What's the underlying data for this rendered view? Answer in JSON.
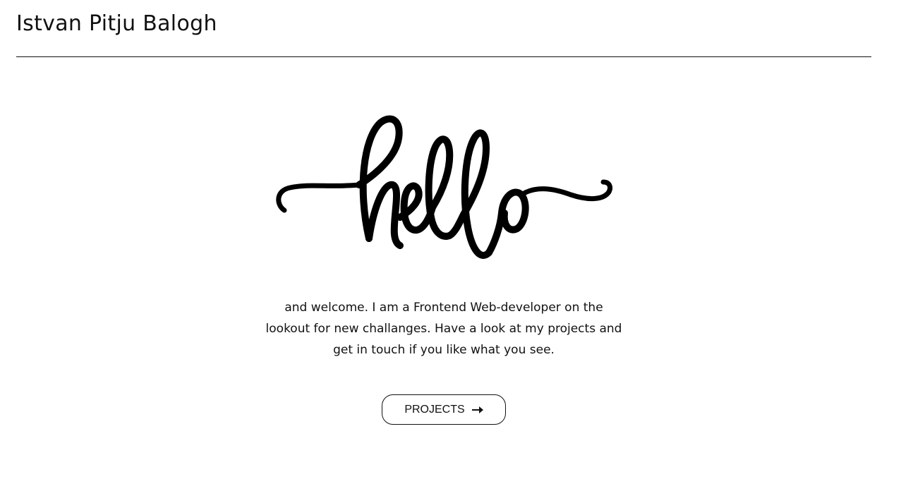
{
  "header": {
    "title": "Istvan Pitju Balogh"
  },
  "hero": {
    "artwork_text": "hello",
    "intro_text": "and welcome. I am a Frontend Web-developer on the lookout for new challanges. Have a look at my projects and get in touch if you like what you see."
  },
  "actions": {
    "projects_label": "PROJECTS",
    "projects_icon": "arrow-right-icon"
  },
  "colors": {
    "text": "#111111",
    "background": "#ffffff"
  }
}
